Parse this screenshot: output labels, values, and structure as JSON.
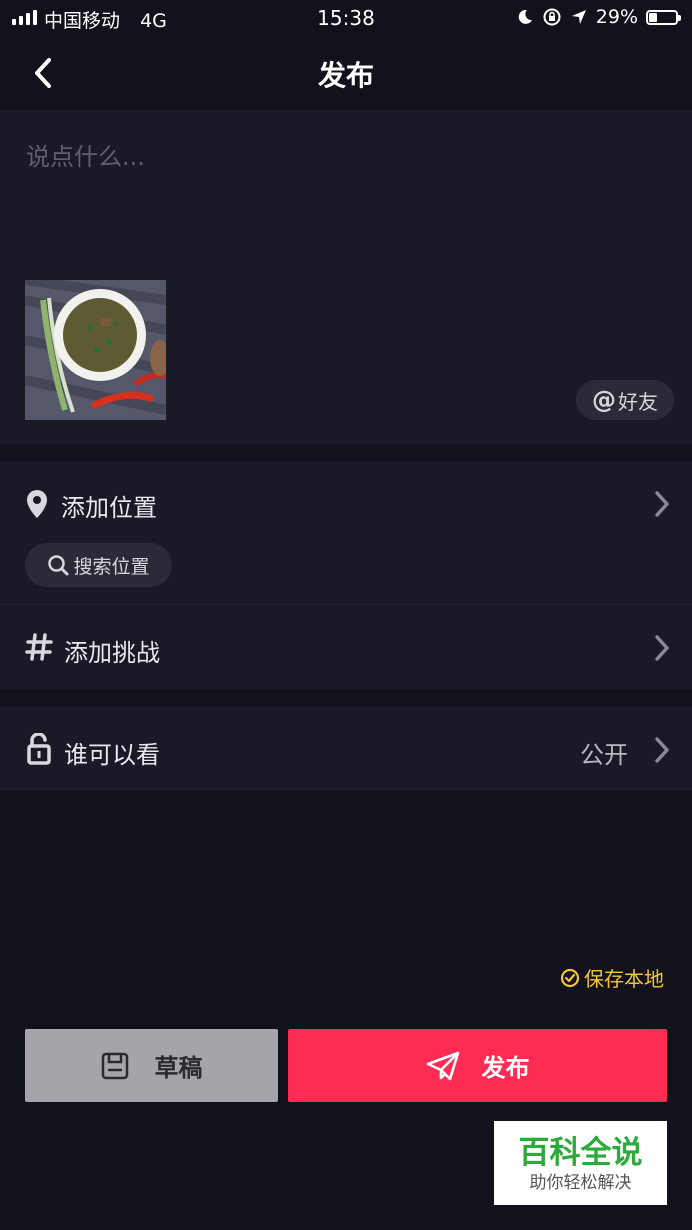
{
  "status_bar": {
    "carrier": "中国移动",
    "network": "4G",
    "time": "15:38",
    "battery": "29%",
    "battery_level": 0.29
  },
  "header": {
    "title": "发布"
  },
  "compose": {
    "placeholder": "说点什么...",
    "mention_label": "好友"
  },
  "location": {
    "label": "添加位置",
    "search_label": "搜索位置"
  },
  "challenge": {
    "label": "添加挑战"
  },
  "visibility": {
    "label": "谁可以看",
    "value": "公开"
  },
  "save_local": {
    "label": "保存本地"
  },
  "buttons": {
    "draft_label": "草稿",
    "publish_label": "发布"
  },
  "watermark": {
    "title": "百科全说",
    "subtitle": "助你轻松解决"
  },
  "colors": {
    "background": "#12121c",
    "card": "#191a26",
    "accent": "#fe2c55",
    "save_local": "#f5c439",
    "draft_button": "#a4a4aa"
  }
}
